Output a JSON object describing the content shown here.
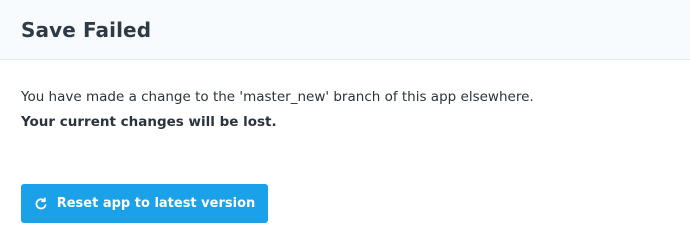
{
  "dialog": {
    "title": "Save Failed",
    "message": "You have made a change to the 'master_new' branch of this app elsewhere.",
    "warning": "Your current changes will be lost.",
    "reset_button": {
      "label": "Reset app to latest version",
      "icon": "refresh-icon"
    }
  },
  "colors": {
    "header_background": "#f7fbfe",
    "button_background": "#1aa1e8",
    "button_text": "#ffffff",
    "title_text": "#2f3a45"
  }
}
